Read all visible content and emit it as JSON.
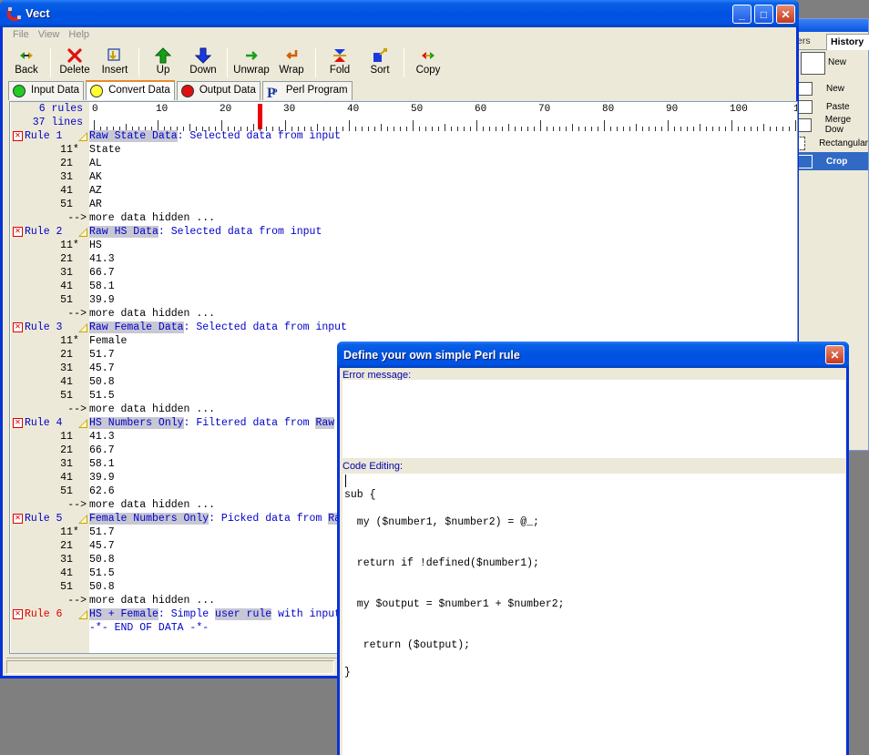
{
  "background_app": {
    "tabs": [
      "ers",
      "History"
    ],
    "new_label": "New",
    "history_items": [
      {
        "label": "New",
        "selected": false
      },
      {
        "label": "Paste",
        "selected": false
      },
      {
        "label": "Merge Dow",
        "selected": false
      },
      {
        "label": "Rectangular",
        "selected": false
      },
      {
        "label": "Crop",
        "selected": true
      }
    ]
  },
  "window": {
    "title": "Vect",
    "controls": {
      "minimize": "_",
      "maximize": "□",
      "close": "✕"
    }
  },
  "menu": [
    "File",
    "View",
    "Help"
  ],
  "toolbar": [
    {
      "label": "Back",
      "icon": "back-icon"
    },
    {
      "label": "Delete",
      "icon": "delete-icon"
    },
    {
      "label": "Insert",
      "icon": "insert-icon"
    },
    {
      "label": "Up",
      "icon": "up-arrow-icon"
    },
    {
      "label": "Down",
      "icon": "down-arrow-icon"
    },
    {
      "label": "Unwrap",
      "icon": "unwrap-icon"
    },
    {
      "label": "Wrap",
      "icon": "wrap-icon"
    },
    {
      "label": "Fold",
      "icon": "fold-icon"
    },
    {
      "label": "Sort",
      "icon": "sort-icon"
    },
    {
      "label": "Copy",
      "icon": "copy-icon"
    }
  ],
  "tabs": [
    {
      "label": "Input Data",
      "color": "#22cc22",
      "active": false
    },
    {
      "label": "Convert Data",
      "color": "#ffff33",
      "active": true
    },
    {
      "label": "Output Data",
      "color": "#dd1111",
      "active": false
    },
    {
      "label": "Perl Program",
      "color": "#1a3aa0",
      "active": false
    }
  ],
  "editor": {
    "rules_count": "6 rules",
    "lines_count": "37 lines",
    "ruler_numbers": [
      "0",
      "10",
      "20",
      "30",
      "40",
      "50",
      "60",
      "70",
      "80",
      "90",
      "100",
      "1"
    ],
    "more_hidden": "-->  more data hidden ...",
    "end_of_data": "-*- END OF DATA -*-",
    "rules": [
      {
        "label": "Rule 1",
        "name": "Raw State Data",
        "desc": ": Selected data from input",
        "rows": [
          [
            "1",
            "1*",
            "State"
          ],
          [
            "2",
            "1",
            "AL"
          ],
          [
            "3",
            "1",
            "AK"
          ],
          [
            "4",
            "1",
            "AZ"
          ],
          [
            "5",
            "1",
            "AR"
          ]
        ],
        "more": true
      },
      {
        "label": "Rule 2",
        "name": "Raw HS Data",
        "desc": ": Selected data from input",
        "rows": [
          [
            "1",
            "1*",
            "HS"
          ],
          [
            "2",
            "1",
            "41.3"
          ],
          [
            "3",
            "1",
            "66.7"
          ],
          [
            "4",
            "1",
            "58.1"
          ],
          [
            "5",
            "1",
            "39.9"
          ]
        ],
        "more": true
      },
      {
        "label": "Rule 3",
        "name": "Raw Female Data",
        "desc": ": Selected data from input",
        "rows": [
          [
            "1",
            "1*",
            "Female"
          ],
          [
            "2",
            "1",
            "51.7"
          ],
          [
            "3",
            "1",
            "45.7"
          ],
          [
            "4",
            "1",
            "50.8"
          ],
          [
            "5",
            "1",
            "51.5"
          ]
        ],
        "more": true
      },
      {
        "label": "Rule 4",
        "name": "HS Numbers Only",
        "desc": ": Filtered data from ",
        "desc_tail": "Raw",
        "rows": [
          [
            "1",
            "1",
            "41.3"
          ],
          [
            "2",
            "1",
            "66.7"
          ],
          [
            "3",
            "1",
            "58.1"
          ],
          [
            "4",
            "1",
            "39.9"
          ],
          [
            "5",
            "1",
            "62.6"
          ]
        ],
        "more": true
      },
      {
        "label": "Rule 5",
        "name": "Female Numbers Only",
        "desc": ": Picked data from ",
        "desc_tail": "Ra",
        "rows": [
          [
            "1",
            "1*",
            "51.7"
          ],
          [
            "2",
            "1",
            "45.7"
          ],
          [
            "3",
            "1",
            "50.8"
          ],
          [
            "4",
            "1",
            "51.5"
          ],
          [
            "5",
            "1",
            "50.8"
          ]
        ],
        "more": true
      },
      {
        "label": "Rule 6",
        "name": "HS + Female",
        "desc_a": ": Simple ",
        "desc_hl": "user rule",
        "desc_b": " with input",
        "rows": [],
        "more": false
      }
    ]
  },
  "dialog": {
    "title": "Define your own simple Perl rule",
    "close": "✕",
    "error_label": "Error message:",
    "code_label": "Code Editing:",
    "code_lines": [
      "",
      "sub {",
      "",
      "  my ($number1, $number2) = @_;",
      "",
      "",
      "  return if !defined($number1);",
      "",
      "",
      "  my $output = $number1 + $number2;",
      "",
      "",
      "   return ($output);",
      "",
      "}"
    ]
  }
}
